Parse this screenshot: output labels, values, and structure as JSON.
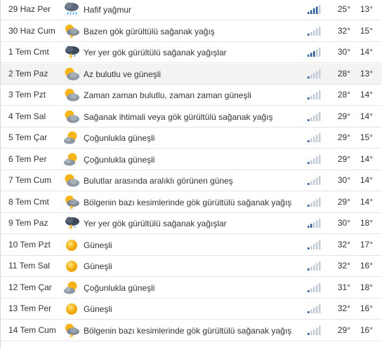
{
  "forecast": {
    "rows": [
      {
        "date": "29 Haz Per",
        "icon": "rain-cloud-icon",
        "description": "Hafif yağmur",
        "rain": 0.8,
        "high": "25°",
        "low": "13°"
      },
      {
        "date": "30 Haz Cum",
        "icon": "thunder-sun-cloud-icon",
        "description": "Bazen gök gürültülü sağanak yağış",
        "rain": 0.2,
        "high": "32°",
        "low": "15°"
      },
      {
        "date": "1 Tem Cmt",
        "icon": "thunderstorm-icon",
        "description": "Yer yer gök gürültülü sağanak yağışlar",
        "rain": 0.6,
        "high": "30°",
        "low": "14°"
      },
      {
        "date": "2 Tem Paz",
        "icon": "partly-cloudy-icon",
        "description": "Az bulutlu ve güneşli",
        "rain": 0.2,
        "high": "28°",
        "low": "13°"
      },
      {
        "date": "3 Tem Pzt",
        "icon": "partly-cloudy-icon",
        "description": "Zaman zaman bulutlu, zaman zaman güneşli",
        "rain": 0.2,
        "high": "28°",
        "low": "14°"
      },
      {
        "date": "4 Tem Sal",
        "icon": "partly-cloudy-icon",
        "description": "Sağanak ihtimali veya gök gürültülü sağanak yağış",
        "rain": 0.2,
        "high": "29°",
        "low": "14°"
      },
      {
        "date": "5 Tem Çar",
        "icon": "mostly-sunny-icon",
        "description": "Çoğunlukla güneşli",
        "rain": 0.2,
        "high": "29°",
        "low": "15°"
      },
      {
        "date": "6 Tem Per",
        "icon": "mostly-sunny-icon",
        "description": "Çoğunlukla güneşli",
        "rain": 0.2,
        "high": "29°",
        "low": "14°"
      },
      {
        "date": "7 Tem Cum",
        "icon": "partly-cloudy-icon",
        "description": "Bulutlar arasında aralıklı görünen güneş",
        "rain": 0.2,
        "high": "30°",
        "low": "14°"
      },
      {
        "date": "8 Tem Cmt",
        "icon": "thunder-sun-cloud-icon",
        "description": "Bölgenin bazı kesimlerinde gök gürültülü sağanak yağış",
        "rain": 0.2,
        "high": "29°",
        "low": "14°"
      },
      {
        "date": "9 Tem Paz",
        "icon": "thunderstorm-icon",
        "description": "Yer yer gök gürültülü sağanak yağışlar",
        "rain": 0.4,
        "high": "30°",
        "low": "18°"
      },
      {
        "date": "10 Tem Pzt",
        "icon": "sun-icon",
        "description": "Güneşli",
        "rain": 0.2,
        "high": "32°",
        "low": "17°"
      },
      {
        "date": "11 Tem Sal",
        "icon": "sun-icon",
        "description": "Güneşli",
        "rain": 0.2,
        "high": "32°",
        "low": "16°"
      },
      {
        "date": "12 Tem Çar",
        "icon": "mostly-sunny-icon",
        "description": "Çoğunlukla güneşli",
        "rain": 0.2,
        "high": "31°",
        "low": "18°"
      },
      {
        "date": "13 Tem Per",
        "icon": "sun-icon",
        "description": "Güneşli",
        "rain": 0.2,
        "high": "32°",
        "low": "16°"
      },
      {
        "date": "14 Tem Cum",
        "icon": "thunder-sun-cloud-icon",
        "description": "Bölgenin bazı kesimlerinde gök gürültülü sağanak yağış",
        "rain": 0.2,
        "high": "29°",
        "low": "16°"
      }
    ],
    "highlight_row": "2 Tem Paz",
    "colors": {
      "bar_on": "#2b5c97",
      "bar_off": "#c3ccd6",
      "sun": "#f6b417",
      "cloud": "#9aa4ad"
    }
  }
}
